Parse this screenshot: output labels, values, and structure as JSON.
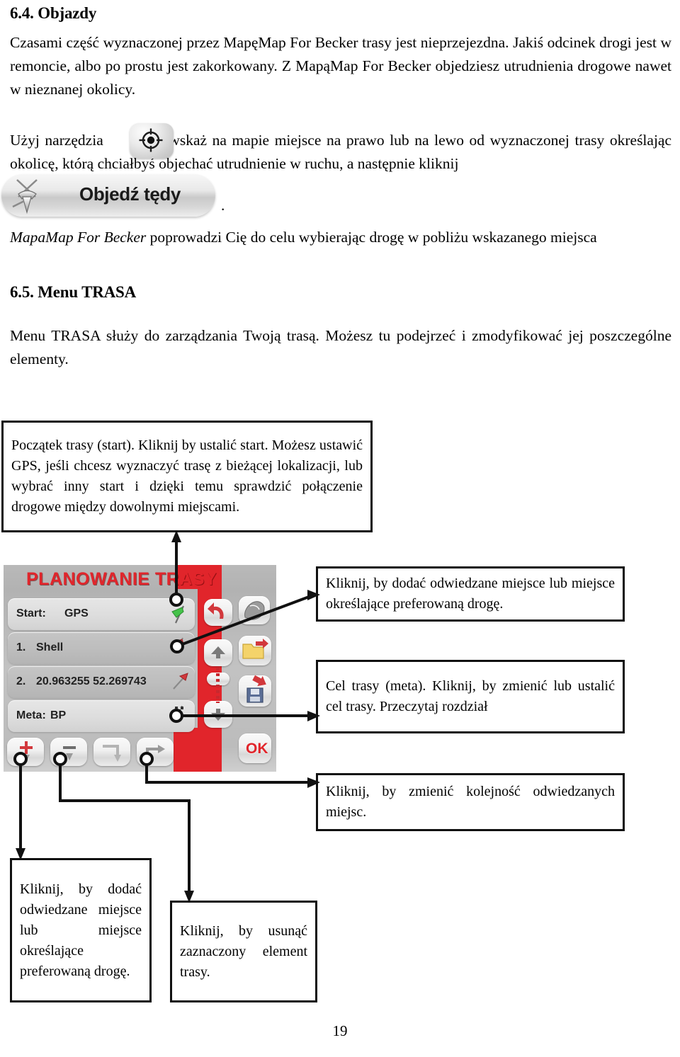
{
  "document": {
    "page_number": "19"
  },
  "sections": {
    "objazdy": {
      "heading": "6.4. Objazdy",
      "intro": "Czasami część wyznaczonej przez MapęMap For Becker trasy jest nieprzejezdna. Jakiś odcinek drogi jest w remoncie, albo po prostu jest zakorkowany. Z MapąMap For Becker objedziesz utrudnienia drogowe nawet w nieznanej okolicy.",
      "tool_text_before": "Użyj narzędzia",
      "tool_text_after": ", wskaż na mapie miejsce na prawo lub na lewo od wyznaczonej trasy określając okolicę, którą chciałbyś objechać utrudnienie w ruchu, a następnie kliknij",
      "button_label": "Objedź tędy",
      "button_period": ".",
      "mapamap_italic": "MapaMap For Becker",
      "mapamap_rest": " poprowadzi Cię do celu wybierając drogę w pobliżu wskazanego miejsca"
    },
    "menu_trasa": {
      "heading": "6.5. Menu TRASA",
      "body": "Menu TRASA służy do zarządzania Twoją trasą. Możesz tu podejrzeć i zmodyfikować jej poszczególne elementy."
    }
  },
  "callouts": {
    "start": "Początek trasy (start). Kliknij by ustalić start. Możesz ustawić GPS, jeśli chcesz wyznaczyć trasę z bieżącej lokalizacji, lub wybrać inny start i dzięki temu sprawdzić połączenie drogowe między dowolnymi miejscami.",
    "add_place_top": "Kliknij, by dodać odwiedzane miejsce lub miejsce określające preferowaną drogę.",
    "destination": "Cel trasy (meta). Kliknij, by zmienić lub ustalić cel trasy. Przeczytaj rozdział",
    "reorder": "Kliknij, by zmienić kolejność odwiedzanych miejsc.",
    "add_place_bottom": "Kliknij, by dodać odwiedzane miejsce lub miejsce określające preferowaną drogę.",
    "delete": "Kliknij, by usunąć zaznaczony element trasy."
  },
  "device": {
    "title": "PLANOWANIE TRASY",
    "rows": [
      {
        "label": "Start:",
        "value": "GPS",
        "kind": "labelled",
        "style": "light"
      },
      {
        "num": "1.",
        "text": "Shell",
        "kind": "numbered",
        "style": "dark"
      },
      {
        "num": "2.",
        "text": "20.963255 52.269743",
        "kind": "numbered",
        "style": "dark"
      },
      {
        "label": "Meta:",
        "value": "BP",
        "kind": "labelled",
        "style": "light"
      }
    ],
    "ok_label": "OK",
    "icons": {
      "row_start": "green-flag-icon",
      "row_waypoint": "red-flag-icon",
      "row_via": "red-arrow-pin-icon",
      "row_meta": "checkered-flag-icon",
      "undo": "undo-arrow-icon",
      "map": "map-region-icon",
      "move_up": "arrow-up-icon",
      "move_down": "arrow-down-icon",
      "open": "open-folder-icon",
      "save": "save-floppy-icon",
      "add": "plus-pin-icon",
      "remove": "minus-pin-icon",
      "reverse": "reverse-route-icon",
      "reorder": "reorder-route-icon"
    }
  },
  "colors": {
    "accent_red": "#e1252b",
    "device_bg": "#bcbcbc",
    "box_border": "#111111",
    "text": "#000000"
  }
}
